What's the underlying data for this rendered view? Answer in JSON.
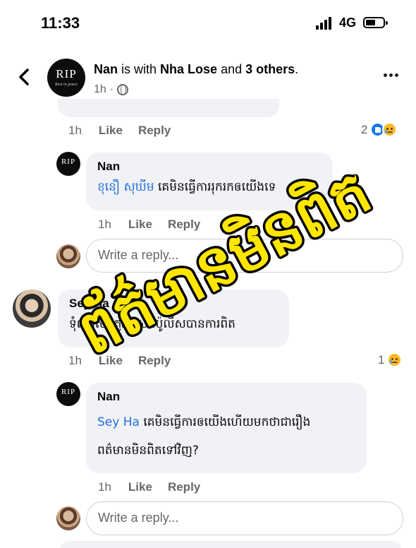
{
  "status_bar": {
    "time": "11:33",
    "network": "4G"
  },
  "header": {
    "avatar_text": "RIP",
    "avatar_subtext": "Rest in peace",
    "author": "Nan",
    "text_with": " is with ",
    "tagged": "Nha Lose",
    "text_and": " and ",
    "others": "3 others",
    "text_end": ".",
    "time": "1h",
    "separator": "·"
  },
  "top_actions": {
    "time": "1h",
    "like": "Like",
    "reply": "Reply",
    "reaction_count": "2"
  },
  "comments": [
    {
      "author": "Nan",
      "avatar_text": "RIP",
      "tag": "ខុនឿ សុឃីម",
      "text": " គេមិនធ្វើការរុករកឲយើងទេ",
      "time": "1h",
      "like": "Like",
      "reply": "Reply"
    },
    {
      "author": "Sey Ha",
      "text": "ទុំណាស់ ត្រូវគ្រួសារប៉ូលីសបានការពិត",
      "time": "1h",
      "like": "Like",
      "reply": "Reply",
      "reaction_count": "1"
    },
    {
      "author": "Nan",
      "avatar_text": "RIP",
      "tag": "Sey Ha",
      "text_line1": " គេមិនធ្វើការឲយើងហើយមកថាជារឿង",
      "text_line2": "ពត៌មានមិនពិតទៅវិញ?",
      "time": "1h",
      "like": "Like",
      "reply": "Reply"
    }
  ],
  "reply_placeholder": "Write a reply...",
  "stamp_text": "ព័ត៌មានមិនពិត",
  "colors": {
    "link": "#216fdb",
    "stamp_fill": "#ffe600",
    "stamp_stroke": "#000000"
  }
}
